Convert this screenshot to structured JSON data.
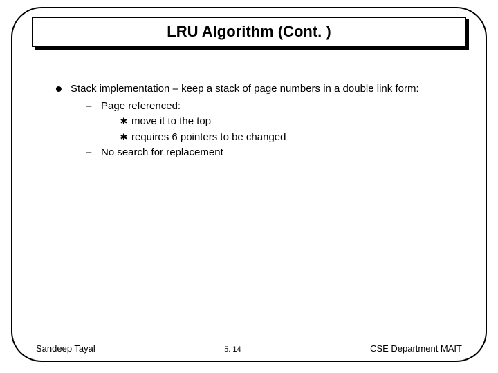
{
  "title": "LRU Algorithm (Cont. )",
  "bullets": {
    "main": "Stack implementation – keep a stack of page numbers in a double link form:",
    "sub1": "Page referenced:",
    "sub1a": "move it to the top",
    "sub1b": "requires 6 pointers to be changed",
    "sub2": "No search for replacement"
  },
  "footer": {
    "left": "Sandeep Tayal",
    "center": "5. 14",
    "right": "CSE Department MAIT"
  }
}
